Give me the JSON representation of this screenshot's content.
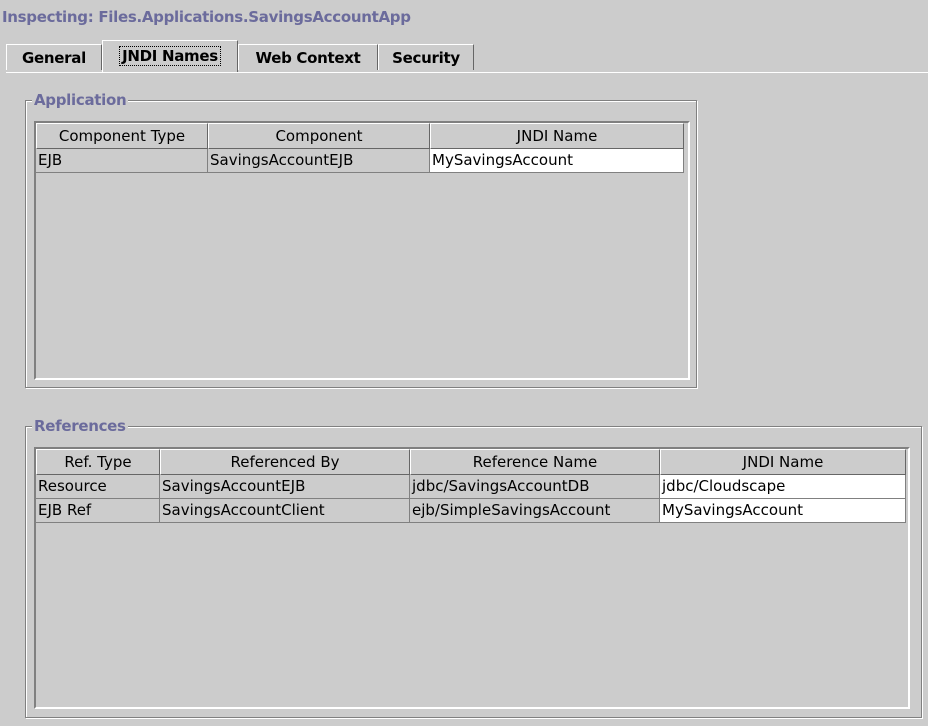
{
  "window": {
    "title": "Inspecting: Files.Applications.SavingsAccountApp"
  },
  "tabs": [
    {
      "label": "General",
      "active": false
    },
    {
      "label": "JNDI Names",
      "active": true
    },
    {
      "label": "Web Context",
      "active": false
    },
    {
      "label": "Security",
      "active": false
    }
  ],
  "application": {
    "label": "Application",
    "columns": [
      "Component Type",
      "Component",
      "JNDI Name"
    ],
    "rows": [
      [
        "EJB",
        "SavingsAccountEJB",
        "MySavingsAccount"
      ]
    ]
  },
  "references": {
    "label": "References",
    "columns": [
      "Ref. Type",
      "Referenced By",
      "Reference Name",
      "JNDI Name"
    ],
    "rows": [
      [
        "Resource",
        "SavingsAccountEJB",
        "jdbc/SavingsAccountDB",
        "jdbc/Cloudscape"
      ],
      [
        "EJB Ref",
        "SavingsAccountClient",
        "ejb/SimpleSavingsAccount",
        "MySavingsAccount"
      ]
    ]
  },
  "colors": {
    "background": "#cccccc",
    "label_accent": "#6b6b9c",
    "editable_cell": "#ffffff"
  }
}
